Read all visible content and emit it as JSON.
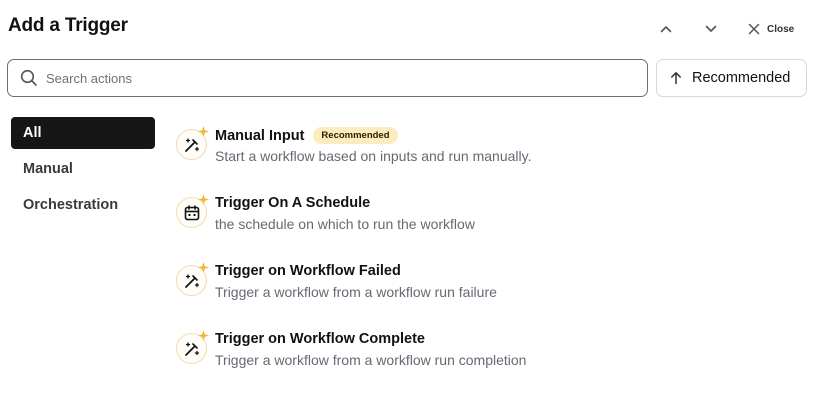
{
  "header": {
    "title": "Add a Trigger",
    "close_label": "Close"
  },
  "search": {
    "placeholder": "Search actions",
    "value": ""
  },
  "sort": {
    "label": "Recommended"
  },
  "sidebar": {
    "items": [
      {
        "label": "All",
        "active": true
      },
      {
        "label": "Manual",
        "active": false
      },
      {
        "label": "Orchestration",
        "active": false
      }
    ]
  },
  "triggers": [
    {
      "title": "Manual Input",
      "badge": "Recommended",
      "description": "Start a workflow based on inputs and run manually.",
      "icon": "magic-wand-icon"
    },
    {
      "title": "Trigger On A Schedule",
      "description": "the schedule on which to run the workflow",
      "icon": "calendar-icon"
    },
    {
      "title": "Trigger on Workflow Failed",
      "description": "Trigger a workflow from a workflow run failure",
      "icon": "magic-wand-icon"
    },
    {
      "title": "Trigger on Workflow Complete",
      "description": "Trigger a workflow from a workflow run completion",
      "icon": "magic-wand-icon"
    }
  ],
  "colors": {
    "accent": "#161616",
    "badge_bg": "#fdecbf",
    "icon_ring": "#f3ddb0",
    "spark": "#f2b632",
    "muted_text": "#646a73"
  }
}
